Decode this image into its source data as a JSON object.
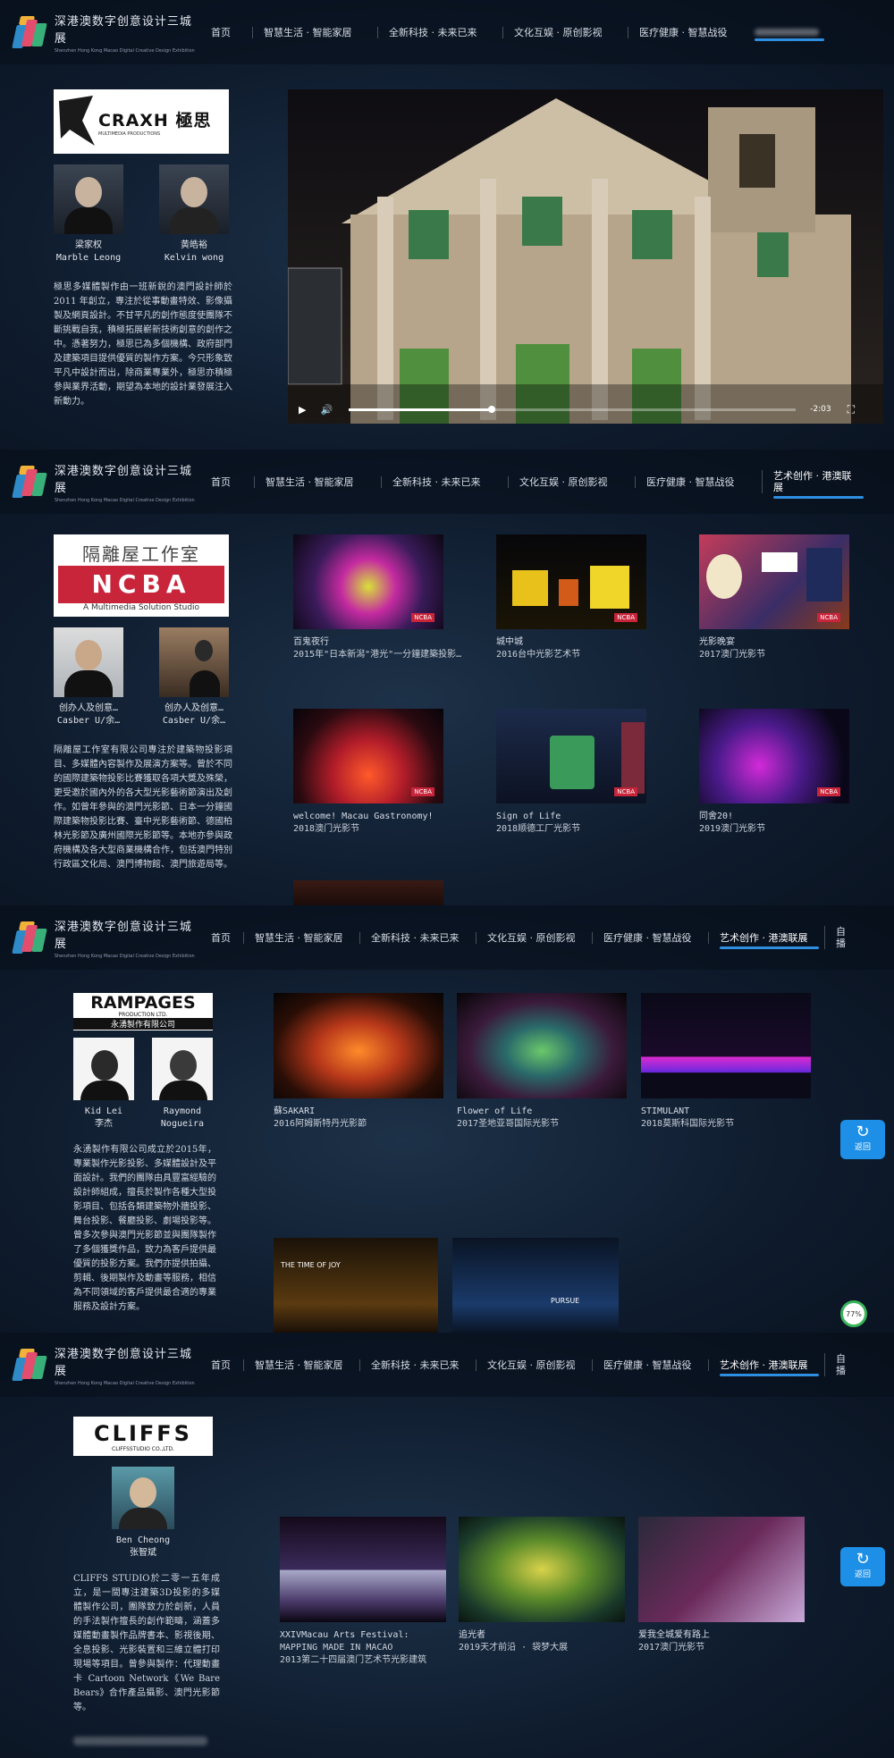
{
  "site": {
    "logo_cn": "深港澳数字创意设计三城展",
    "logo_en": "Shenzhen Hong Kong Macao Digital Creative Design Exhibition"
  },
  "nav1": {
    "items": [
      "首页",
      "智慧生活 · 智能家居",
      "全新科技 · 未来已来",
      "文化互娱 · 原创影视",
      "医疗健康 · 智慧战役"
    ]
  },
  "nav2": {
    "items": [
      "首页",
      "智慧生活 · 智能家居",
      "全新科技 · 未来已来",
      "文化互娱 · 原创影视",
      "医疗健康 · 智慧战役",
      "艺术创作 · 港澳联展"
    ]
  },
  "nav3": {
    "items": [
      "首页",
      "智慧生活 · 智能家居",
      "全新科技 · 未来已来",
      "文化互娱 · 原创影视",
      "医疗健康 · 智慧战役",
      "艺术创作 · 港澳联展",
      "自播"
    ]
  },
  "nav4": {
    "items": [
      "首页",
      "智慧生活 · 智能家居",
      "全新科技 · 未来已来",
      "文化互娱 · 原创影视",
      "医疗健康 · 智慧战役",
      "艺术创作 · 港澳联展",
      "自播"
    ]
  },
  "s1": {
    "logo": "CRAXH 極思",
    "logo_sub": "MULTIMEDIA PRODUCTIONS",
    "people": [
      {
        "cn": "梁家权",
        "en": "Marble Leong"
      },
      {
        "cn": "黄皓裕",
        "en": "Kelvin wong"
      }
    ],
    "desc": "極思多媒體製作由一班新銳的澳門設計師於 2011 年創立，專注於從事動畫特效、影像攝製及網頁設計。不甘平凡的創作態度使團隊不斷挑戰自我，積極拓展嶄新技術創意的創作之中。憑著努力，極思已為多個機構、政府部門及建築項目提供優質的製作方案。今只形象致平凡中設計而出，除商業專業外，極思亦積極參與業界活動，期望為本地的設計業發展注入新動力。",
    "video": {
      "time": "-2:03",
      "progress": 0.32,
      "caption": ""
    }
  },
  "s2": {
    "logo_cn": "隔離屋工作室",
    "logo_big": "NCBA",
    "logo_sub": "A Multimedia Solution Studio",
    "people": [
      {
        "cn": "创办人及创意…",
        "en": "Casber U/余…"
      },
      {
        "cn": "创办人及创意…",
        "en": "Casber U/余…"
      }
    ],
    "desc": "隔離屋工作室有限公司專注於建築物投影項目、多媒體內容製作及展演方案等。曾於不同的國際建築物投影比賽獲取各項大獎及殊榮，更受邀於國內外的各大型光影藝術節演出及創作。如曾年參與的澳門光影節、日本一分鐘國際建築物投影比賽、臺中光影藝術節、德國柏林光影節及廣州國際光影節等。本地亦參與政府機構及各大型商業機構合作，包括澳門特別行政區文化局、澳門博物館、澳門旅遊局等。",
    "works": [
      {
        "t1": "百鬼夜行",
        "t2": "2015年\"日本新潟\"港光\"一分鐘建築投影…"
      },
      {
        "t1": "城中城",
        "t2": "2016台中光影艺术节"
      },
      {
        "t1": "光影晚宴",
        "t2": "2017澳门光影节"
      },
      {
        "t1": "welcome! Macau Gastronomy!",
        "t2": "2018澳门光影节"
      },
      {
        "t1": "Sign of Life",
        "t2": "2018顺德工厂光影节"
      },
      {
        "t1": "同舍20!",
        "t2": "2019澳门光影节"
      }
    ],
    "badge": "NCBA"
  },
  "s3": {
    "logo": "RAMPAGES",
    "logo_sub1": "PRODUCTION LTD.",
    "logo_sub2": "永湧製作有限公司",
    "people": [
      {
        "cn": "Kid Lei",
        "en": "李杰"
      },
      {
        "cn": "Raymond",
        "en": "Nogueira"
      }
    ],
    "desc": "永湧製作有限公司成立於2015年，專業製作光影投影、多媒體設計及平面設計。我們的團隊由具豐富經驗的設計師組成，擅長於製作各種大型投影項目、包括各類建築物外牆投影、舞台投影、餐廳投影、劇場投影等。曾多次參與澳門光影節並與團隊製作了多個獲獎作品，致力為客戶提供最優質的投影方案。我們亦提供拍攝、剪輯、後期製作及動畫等服務，相信為不同領域的客戶提供最合適的專業服務及設計方案。",
    "works": [
      {
        "t1": "蘇SAKARI",
        "t2": "2016阿姆斯特丹光影節"
      },
      {
        "t1": "Flower of Life",
        "t2": "2017圣地亚哥国际光影节"
      },
      {
        "t1": "STIMULANT",
        "t2": "2018莫斯科国际光影节"
      }
    ],
    "extra": [
      "THE TIME OF JOY",
      "PURSUE"
    ],
    "float_btn": "返回",
    "status": "77%"
  },
  "s4": {
    "logo": "CLIFFS",
    "logo_sub": "CLIFFSSTUDIO CO.,LTD.",
    "person": {
      "cn": "Ben Cheong",
      "en": "张智斌"
    },
    "desc": "CLIFFS STUDIO於二零一五年成立，是一間專注建築3D投影的多媒體製作公司，團隊致力於創新，人員的手法製作擅長的創作範疇，涵蓋多媒體動畫製作品牌書本、影視後期、全息投影、光影裝置和三維立體打印現場等項目。曾參與製作：代理動畫卡 Cartoon Network《We Bare Bears》合作產品攝影、澳門光影節等。",
    "works": [
      {
        "t1": "XXIVMacau Arts Festival:",
        "t2": "MAPPING MADE IN MACAO",
        "t3": "2013第二十四届澳门艺术节光影建筑"
      },
      {
        "t1": "追光者",
        "t2": "2019天才前沿 · 袋梦大展",
        "t3": ""
      },
      {
        "t1": "爱我全城爱有路上",
        "t2": "2017澳门光影节",
        "t3": ""
      }
    ],
    "float_btn": "返回"
  }
}
